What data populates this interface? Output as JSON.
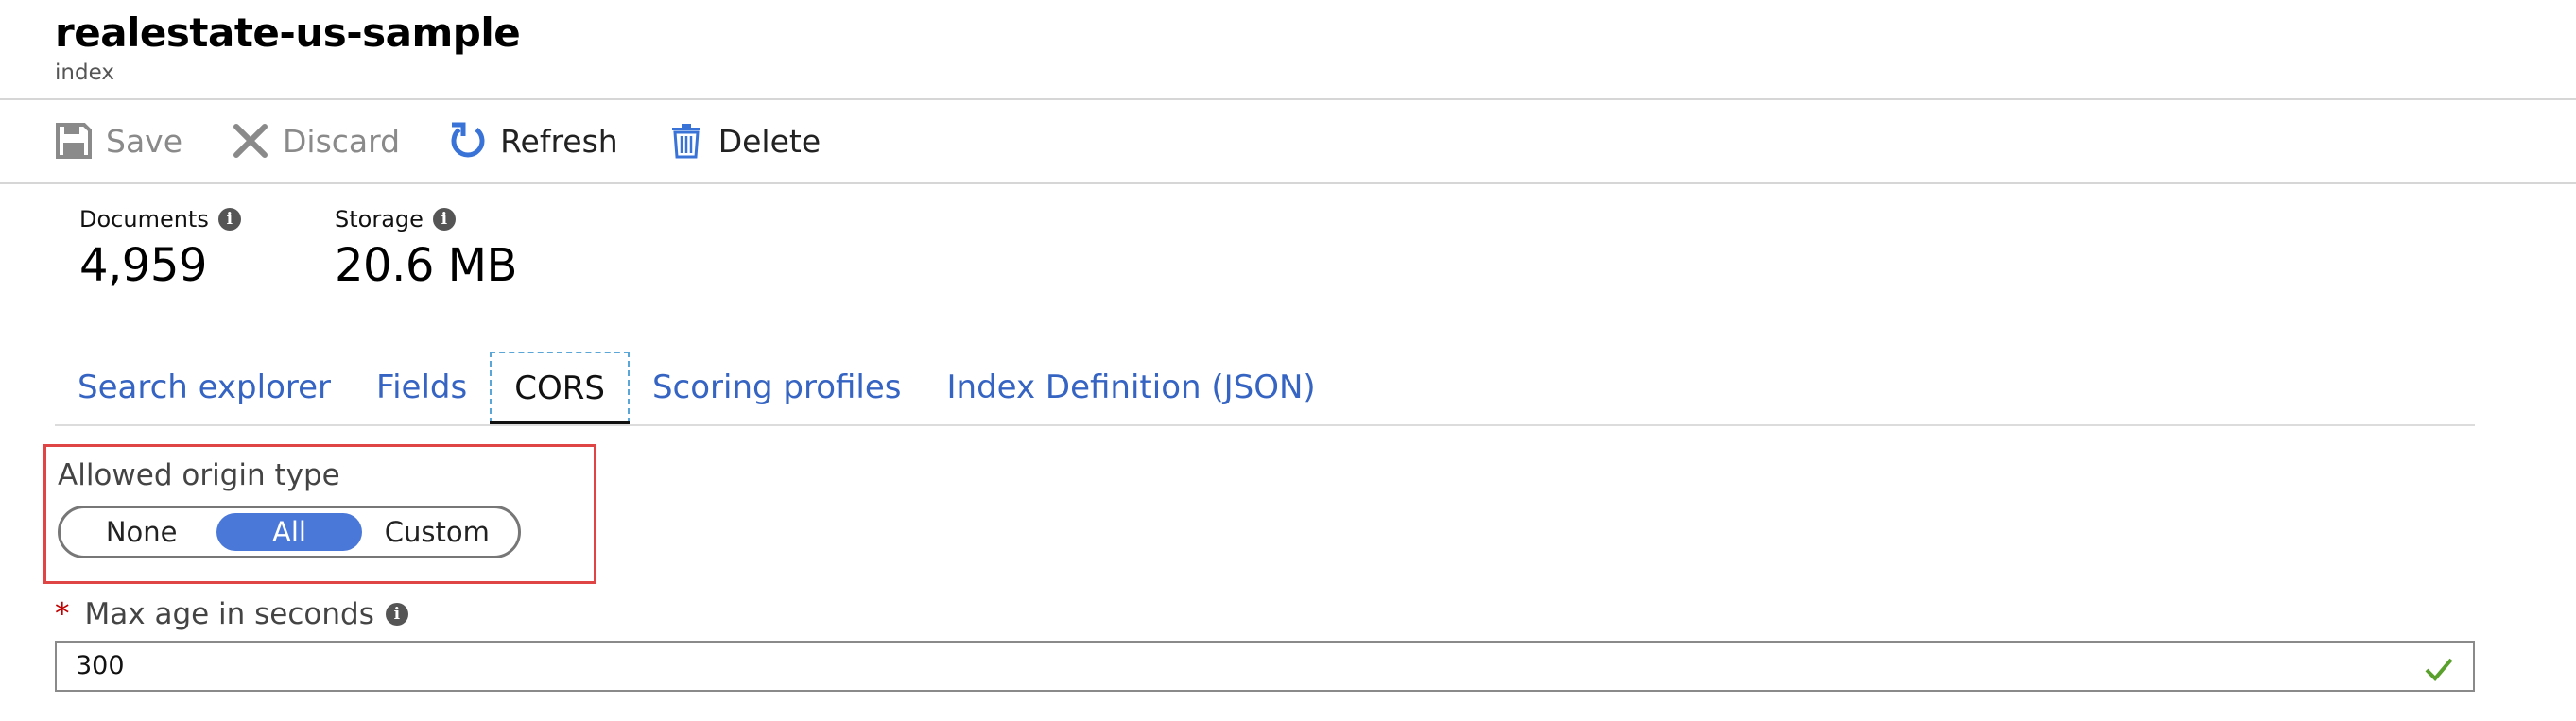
{
  "header": {
    "title": "realestate-us-sample",
    "subtitle": "index"
  },
  "toolbar": {
    "save_label": "Save",
    "discard_label": "Discard",
    "refresh_label": "Refresh",
    "delete_label": "Delete"
  },
  "stats": {
    "documents_label": "Documents",
    "documents_value": "4,959",
    "storage_label": "Storage",
    "storage_value": "20.6 MB"
  },
  "tabs": [
    {
      "label": "Search explorer",
      "active": false
    },
    {
      "label": "Fields",
      "active": false
    },
    {
      "label": "CORS",
      "active": true
    },
    {
      "label": "Scoring profiles",
      "active": false
    },
    {
      "label": "Index Definition (JSON)",
      "active": false
    }
  ],
  "cors": {
    "origin_type_label": "Allowed origin type",
    "options": [
      "None",
      "All",
      "Custom"
    ],
    "selected": "All",
    "max_age_label": "Max age in seconds",
    "max_age_value": "300",
    "required_mark": "*"
  },
  "icons": {
    "save": "save-icon",
    "discard": "discard-x-icon",
    "refresh": "refresh-icon",
    "delete": "trash-icon",
    "info": "info-icon",
    "valid": "checkmark-icon"
  },
  "colors": {
    "link_blue": "#3564c3",
    "toggle_selected": "#4a78d9",
    "highlight_border": "#e04545",
    "valid_check": "#5aa02c",
    "required_star": "#c00000"
  }
}
